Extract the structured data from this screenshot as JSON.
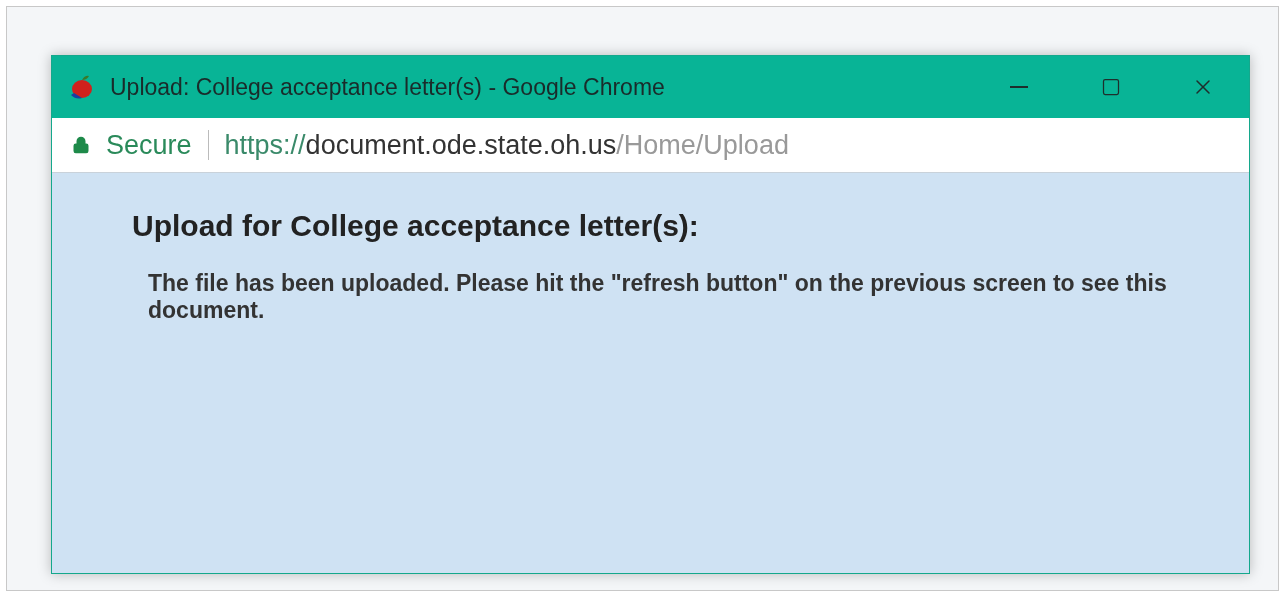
{
  "window": {
    "title": "Upload: College acceptance letter(s) - Google Chrome",
    "controls": [
      {
        "kind": "minimize"
      },
      {
        "kind": "maximize"
      },
      {
        "kind": "close"
      }
    ]
  },
  "address_bar": {
    "security": "Secure",
    "url": {
      "scheme": "https://",
      "host": "document.ode.state.oh.us",
      "path": "/Home/Upload"
    }
  },
  "page": {
    "heading": "Upload for College acceptance letter(s):",
    "message": "The file has been uploaded. Please hit the \"refresh button\" on the previous screen to see this document."
  }
}
